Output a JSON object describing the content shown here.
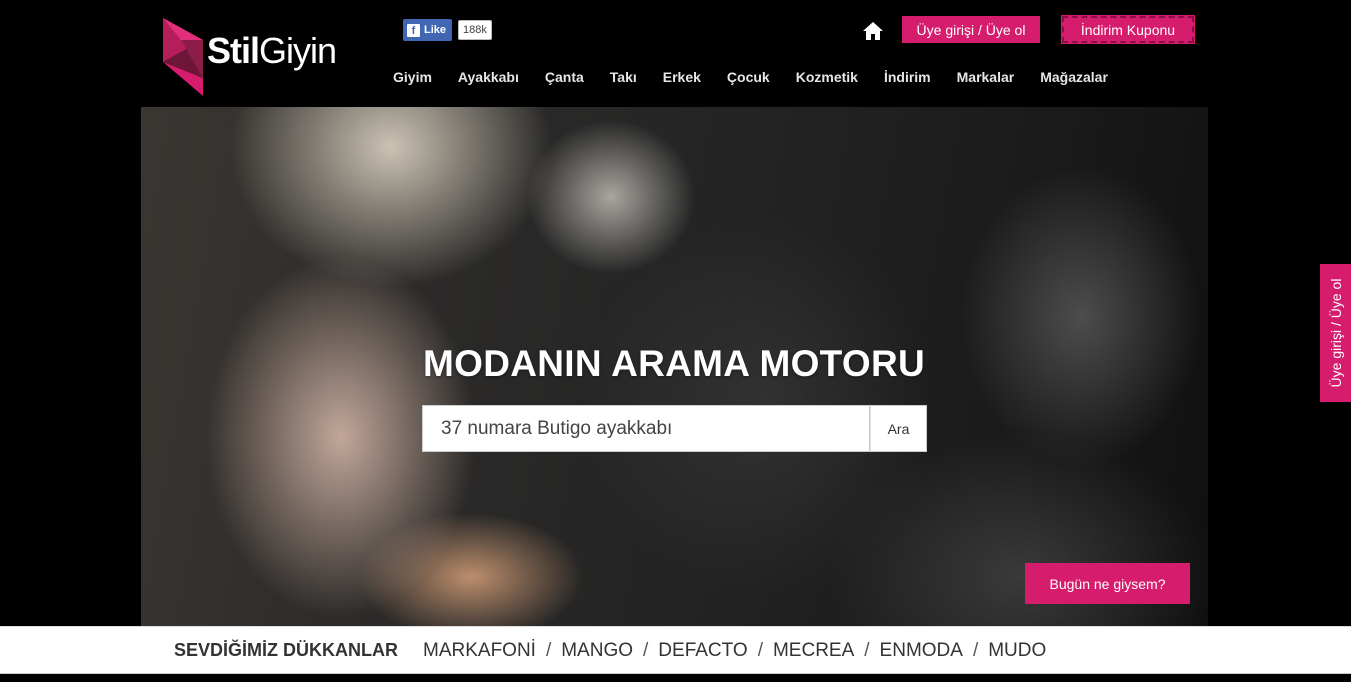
{
  "brand": {
    "name_bold": "Stil",
    "name_rest": "Giyin"
  },
  "facebook": {
    "like_label": "Like",
    "count": "188k"
  },
  "header": {
    "home_icon": "home-icon",
    "login_label": "Üye girişi / Üye ol",
    "coupon_label": "İndirim Kuponu"
  },
  "nav": {
    "items": [
      "Giyim",
      "Ayakkabı",
      "Çanta",
      "Takı",
      "Erkek",
      "Çocuk",
      "Kozmetik",
      "İndirim",
      "Markalar",
      "Mağazalar"
    ]
  },
  "hero": {
    "title": "MODANIN ARAMA MOTORU",
    "search_value": "37 numara Butigo ayakkabı",
    "search_button": "Ara",
    "today_button": "Bugün ne giysem?"
  },
  "side_tab": {
    "label": "Üye girişi / Üye ol"
  },
  "stores": {
    "title": "SEVDİĞİMİZ DÜKKANLAR",
    "items": [
      "MARKAFONİ",
      "MANGO",
      "DEFACTO",
      "MECREA",
      "ENMODA",
      "MUDO"
    ],
    "separator": "/"
  },
  "colors": {
    "accent": "#d61c6c",
    "background": "#000000",
    "facebook": "#4267b2"
  }
}
